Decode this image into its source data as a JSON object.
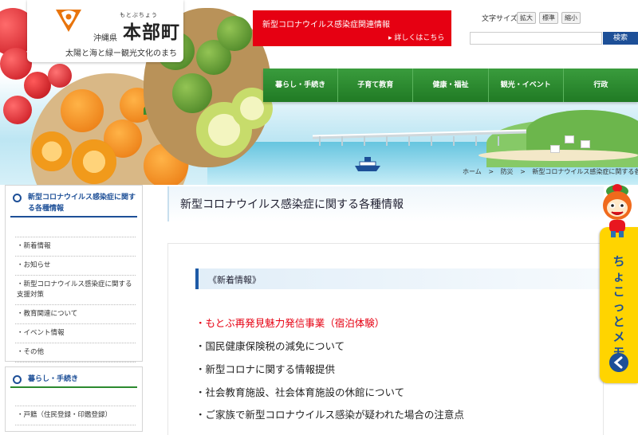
{
  "logo": {
    "prefecture": "沖縄県",
    "ruby": "もとぶちょう",
    "town_name": "本部町",
    "tagline": "太陽と海と緑ー観光文化のまち"
  },
  "covid_banner": {
    "title": "新型コロナウイルス感染症関連情報",
    "detail_link": "詳しくはこちら"
  },
  "font_size": {
    "label": "文字サイズ",
    "enlarge": "拡大",
    "standard": "標準",
    "shrink": "縮小"
  },
  "search": {
    "placeholder": "",
    "button": "検索"
  },
  "global_nav": [
    "暮らし・手続き",
    "子育て教育",
    "健康・福祉",
    "観光・イベント",
    "行政"
  ],
  "breadcrumb": [
    "ホーム",
    ">",
    "防災",
    ">",
    "新型コロナウイルス感染症に関する各"
  ],
  "sidebar": {
    "section1_title": "新型コロナウイルス感染症に関する各種情報",
    "section1_items": [
      "・新着情報",
      "・お知らせ",
      "・新型コロナウイルス感染症に関する支援対策",
      "・教育関連について",
      "・イベント情報",
      "・その他"
    ],
    "section2_title": "暮らし・手続き",
    "section2_items": [
      "・戸籍（住民登録・印鑑登録）"
    ]
  },
  "main": {
    "page_title": "新型コロナウイルス感染症に関する各種情報",
    "news_heading": "《新着情報》",
    "news_items": [
      "・もとぶ再発見魅力発信事業（宿泊体験）",
      "・国民健康保険税の減免について",
      "・新型コロナに関する情報提供",
      "・社会教育施設、社会体育施設の休館について",
      "・ご家族で新型コロナウイルス感染が疑われた場合の注意点"
    ]
  },
  "memo_tab": {
    "label": "ちょこっとメモ"
  },
  "colors": {
    "accent_blue": "#1d4f97",
    "nav_green": "#2c8a2f",
    "alert_red": "#e60012",
    "memo_yellow": "#ffd400"
  }
}
